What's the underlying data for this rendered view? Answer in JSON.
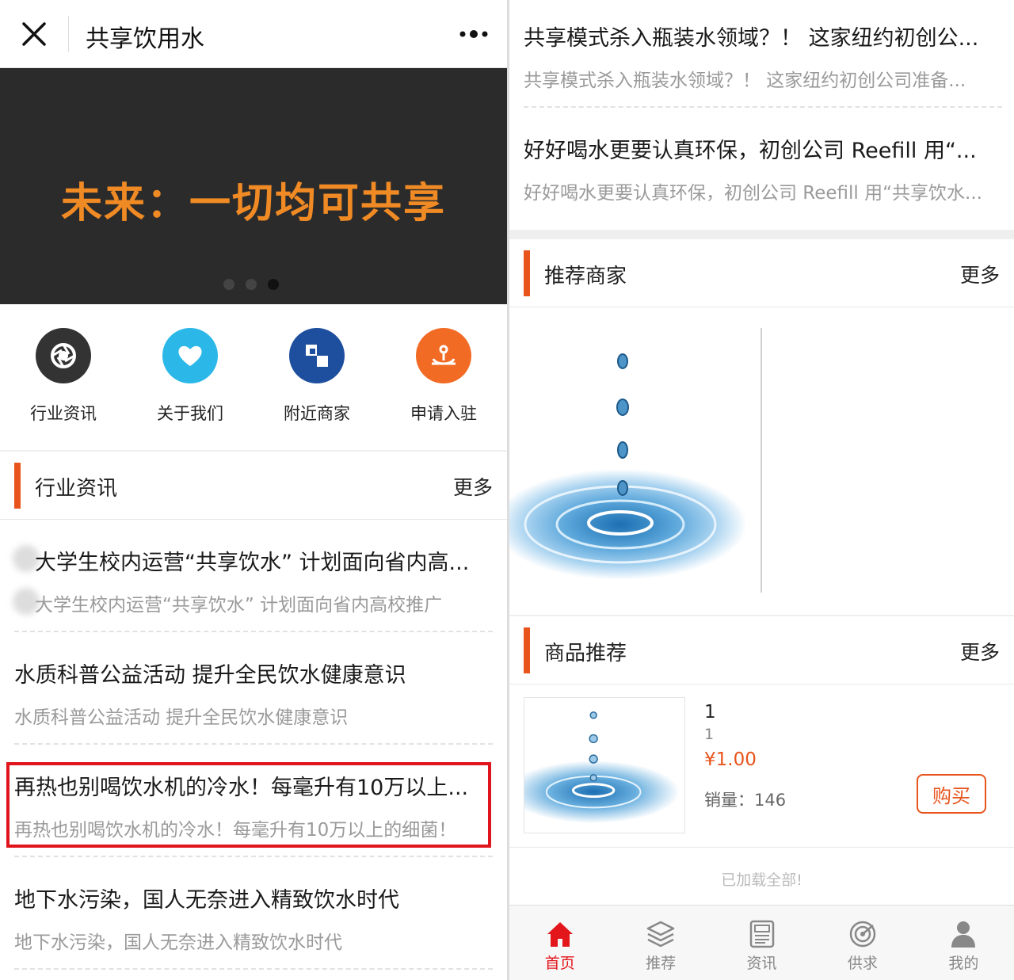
{
  "header": {
    "title": "共享饮用水"
  },
  "banner": {
    "text": "未来：一切均可共享",
    "slides": 3,
    "active_slide": 3
  },
  "quick_links": [
    {
      "label": "行业资讯",
      "icon": "aperture-icon",
      "color": "#333333"
    },
    {
      "label": "关于我们",
      "icon": "heart-icon",
      "color": "#2bb8e8"
    },
    {
      "label": "附近商家",
      "icon": "grid-icon",
      "color": "#1d4f9e"
    },
    {
      "label": "申请入驻",
      "icon": "hand-icon",
      "color": "#f26b25"
    }
  ],
  "industry_news": {
    "title": "行业资讯",
    "more": "更多",
    "items": [
      {
        "title": "大学生校内运营“共享饮水” 计划面向省内高...",
        "summary": "大学生校内运营“共享饮水” 计划面向省内高校推广"
      },
      {
        "title": "水质科普公益活动 提升全民饮水健康意识",
        "summary": "水质科普公益活动 提升全民饮水健康意识"
      },
      {
        "title": "再热也别喝饮水机的冷水！每毫升有10万以上...",
        "summary": "再热也别喝饮水机的冷水！每毫升有10万以上的细菌！"
      },
      {
        "title": "地下水污染，国人无奈进入精致饮水时代",
        "summary": "地下水污染，国人无奈进入精致饮水时代"
      }
    ]
  },
  "right_news": [
    {
      "title": "共享模式杀入瓶装水领域？！ 这家纽约初创公...",
      "summary": "共享模式杀入瓶装水领域？！ 这家纽约初创公司准备..."
    },
    {
      "title": "好好喝水更要认真环保，初创公司 Reefill 用“...",
      "summary": "好好喝水更要认真环保，初创公司 Reefill 用“共享饮水..."
    }
  ],
  "recommended_merchants": {
    "title": "推荐商家",
    "more": "更多"
  },
  "product_recommend": {
    "title": "商品推荐",
    "more": "更多",
    "product": {
      "name": "1",
      "desc": "1",
      "price": "¥1.00",
      "sales_label": "销量：",
      "sales_value": "146",
      "buy_label": "购买"
    }
  },
  "loaded_all": "已加载全部!",
  "tabbar": [
    {
      "label": "首页",
      "icon": "home-icon",
      "active": true
    },
    {
      "label": "推荐",
      "icon": "layers-icon",
      "active": false
    },
    {
      "label": "资讯",
      "icon": "news-icon",
      "active": false
    },
    {
      "label": "供求",
      "icon": "target-icon",
      "active": false
    },
    {
      "label": "我的",
      "icon": "user-icon",
      "active": false
    }
  ],
  "colors": {
    "accent": "#e8541c",
    "banner_text": "#f08a24",
    "highlight": "#e0141c",
    "tab_active": "#e3161b"
  }
}
